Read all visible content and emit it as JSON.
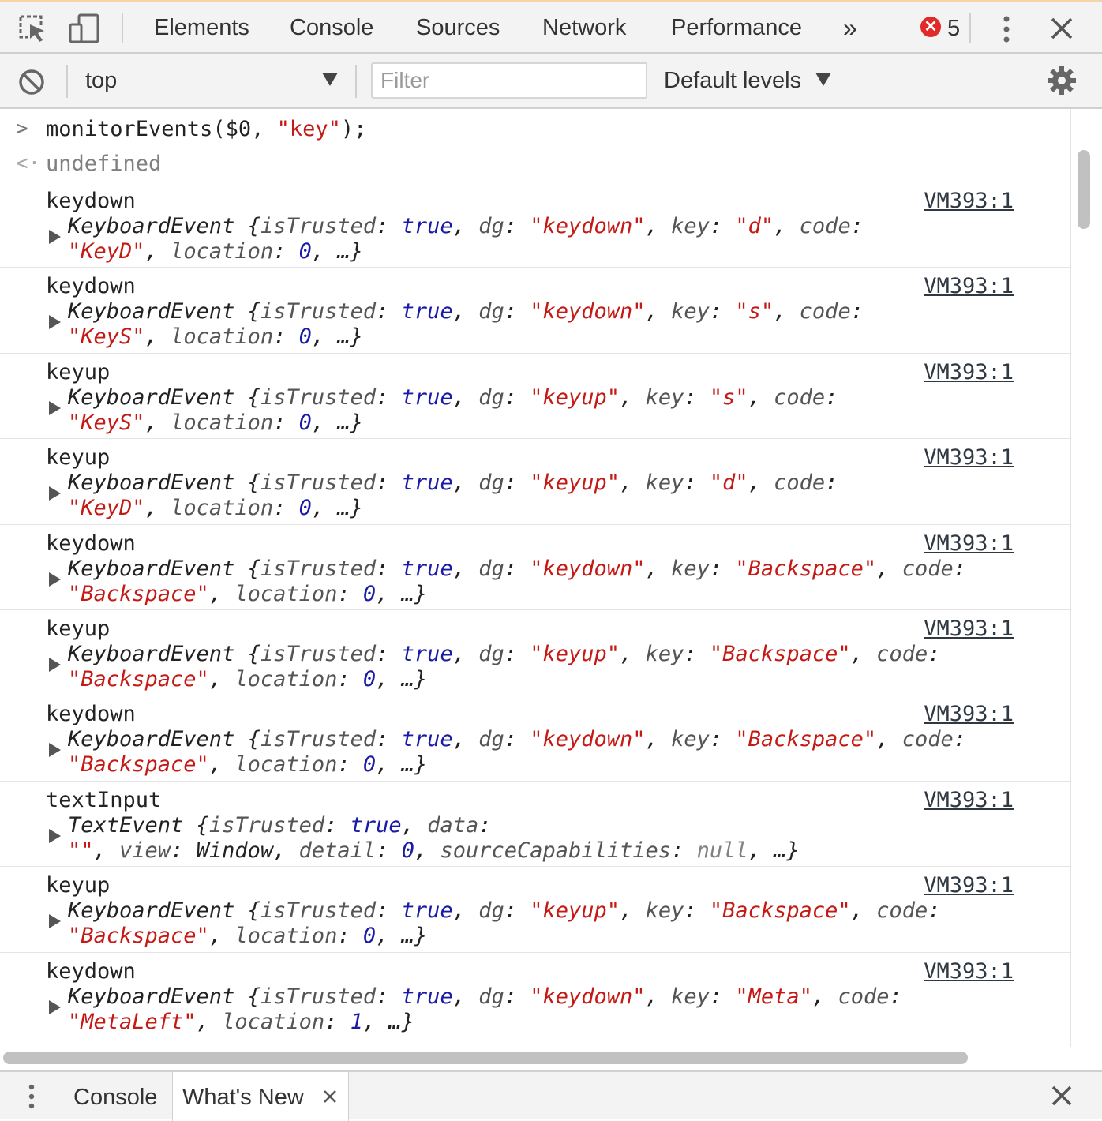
{
  "tabs": {
    "items": [
      "Elements",
      "Console",
      "Sources",
      "Network",
      "Performance"
    ],
    "active": "Console",
    "more": "»",
    "error_count": "5"
  },
  "toolbar": {
    "context": "top",
    "filter_placeholder": "Filter",
    "levels": "Default levels"
  },
  "console": {
    "input": "monitorEvents($0, \"key\");",
    "result": "undefined",
    "source": "VM393:1",
    "entries": [
      {
        "name": "keydown",
        "line1": "KeyboardEvent {isTrusted: true, dg: \"keydown\", key: \"d\", code:",
        "line2": "\"KeyD\", location: 0, …}"
      },
      {
        "name": "keydown",
        "line1": "KeyboardEvent {isTrusted: true, dg: \"keydown\", key: \"s\", code:",
        "line2": "\"KeyS\", location: 0, …}"
      },
      {
        "name": "keyup",
        "line1": "KeyboardEvent {isTrusted: true, dg: \"keyup\", key: \"s\", code:",
        "line2": "\"KeyS\", location: 0, …}"
      },
      {
        "name": "keyup",
        "line1": "KeyboardEvent {isTrusted: true, dg: \"keyup\", key: \"d\", code:",
        "line2": "\"KeyD\", location: 0, …}"
      },
      {
        "name": "keydown",
        "line1": "KeyboardEvent {isTrusted: true, dg: \"keydown\", key: \"Backspace\", code:",
        "line2": "\"Backspace\", location: 0, …}"
      },
      {
        "name": "keyup",
        "line1": "KeyboardEvent {isTrusted: true, dg: \"keyup\", key: \"Backspace\", code:",
        "line2": "\"Backspace\", location: 0, …}"
      },
      {
        "name": "keydown",
        "line1": "KeyboardEvent {isTrusted: true, dg: \"keydown\", key: \"Backspace\", code:",
        "line2": "\"Backspace\", location: 0, …}"
      },
      {
        "name": "textInput",
        "line1": "TextEvent {isTrusted: true, data:",
        "line2": "\"\", view: Window, detail: 0, sourceCapabilities: null, …}"
      },
      {
        "name": "keyup",
        "line1": "KeyboardEvent {isTrusted: true, dg: \"keyup\", key: \"Backspace\", code:",
        "line2": "\"Backspace\", location: 0, …}"
      },
      {
        "name": "keydown",
        "line1": "KeyboardEvent {isTrusted: true, dg: \"keydown\", key: \"Meta\", code:",
        "line2": "\"MetaLeft\", location: 1, …}"
      }
    ]
  },
  "drawer": {
    "tabs": [
      "Console",
      "What's New"
    ],
    "active": "What's New"
  },
  "colors": {
    "active_tab_underline": "#1a73e8",
    "error_badge": "#e22a2a",
    "string": "#c41a16",
    "keyword": "#1a1aa6"
  },
  "icons": [
    "inspect-element-icon",
    "device-toolbar-icon",
    "more-tabs-icon",
    "error-icon",
    "kebab-menu-icon",
    "close-icon",
    "clear-console-icon",
    "dropdown-arrow-icon",
    "settings-gear-icon",
    "expand-triangle-icon",
    "prompt-chevron-icon",
    "result-chevron-icon",
    "drawer-menu-icon",
    "close-tab-icon",
    "close-drawer-icon"
  ]
}
